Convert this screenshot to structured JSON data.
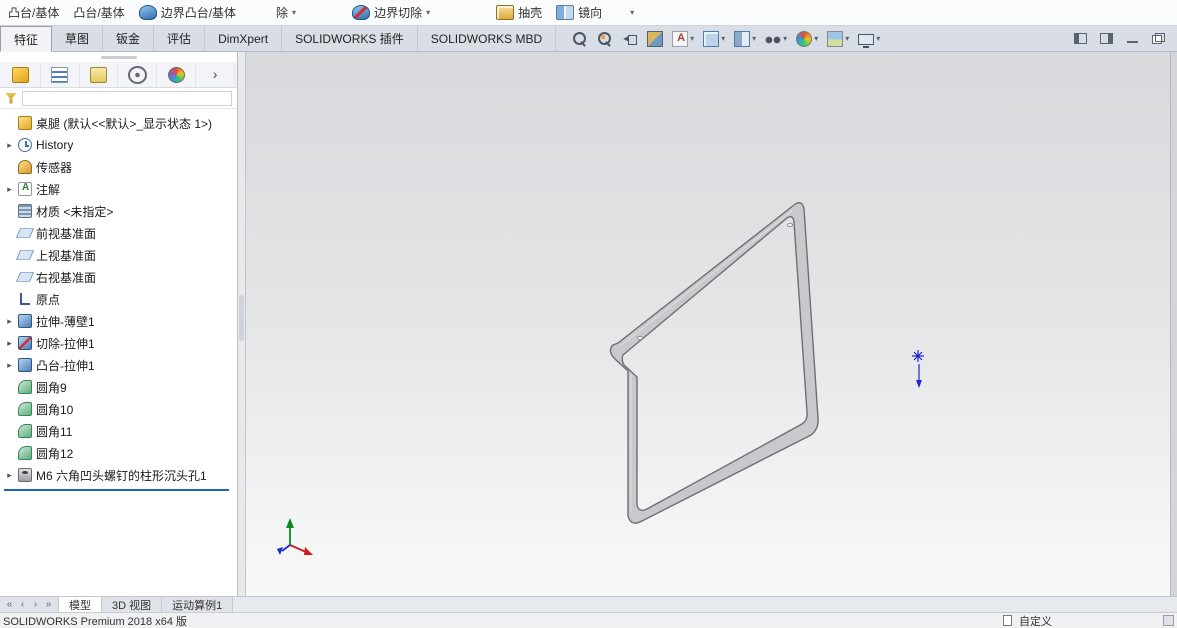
{
  "ribbon": {
    "items": [
      {
        "label": "凸台/基体",
        "icon": "",
        "caret": false
      },
      {
        "label": "凸台/基体",
        "icon": "",
        "caret": false
      },
      {
        "label": "边界凸台/基体",
        "icon": "boundary-boss-icon",
        "caret": false
      },
      {
        "label": "除",
        "icon": "",
        "caret": true
      },
      {
        "label": "边界切除",
        "icon": "boundary-cut-icon",
        "caret": true
      },
      {
        "label": "抽壳",
        "icon": "shell-icon",
        "caret": false
      },
      {
        "label": "镜向",
        "icon": "mirror-icon",
        "caret": false
      },
      {
        "label": "",
        "icon": "",
        "caret": true
      }
    ]
  },
  "tabs": [
    {
      "label": "特征",
      "active": true
    },
    {
      "label": "草图"
    },
    {
      "label": "钣金"
    },
    {
      "label": "评估"
    },
    {
      "label": "DimXpert"
    },
    {
      "label": "SOLIDWORKS 插件"
    },
    {
      "label": "SOLIDWORKS MBD"
    }
  ],
  "view_toolbar": [
    {
      "name": "zoom-fit-icon",
      "caret": false
    },
    {
      "name": "zoom-area-icon",
      "caret": false
    },
    {
      "name": "previous-view-icon",
      "caret": false
    },
    {
      "name": "section-view-icon",
      "caret": false
    },
    {
      "name": "annotation-view-icon",
      "caret": true
    },
    {
      "name": "view-orientation-icon",
      "caret": true
    },
    {
      "name": "display-style-icon",
      "caret": true
    },
    {
      "name": "hide-show-items-icon",
      "caret": true
    },
    {
      "name": "edit-appearance-icon",
      "caret": true
    },
    {
      "name": "apply-scene-icon",
      "caret": true
    },
    {
      "name": "view-settings-icon",
      "caret": true
    }
  ],
  "window_controls": [
    "panel-left-icon",
    "panel-right-icon",
    "minimize-icon",
    "restore-icon"
  ],
  "panel": {
    "tabs": [
      "part-tab-icon",
      "featuremanager-tab-icon",
      "configurationmanager-tab-icon",
      "dimxpertmanager-tab-icon",
      "displaymanager-tab-icon",
      "expand-panel-icon"
    ],
    "filter_value": ""
  },
  "tree": {
    "items": [
      {
        "label": "桌腿 (默认<<默认>_显示状态 1>)",
        "icon": "part-icon",
        "expand": false
      },
      {
        "label": "History",
        "icon": "history-icon",
        "expand": true
      },
      {
        "label": "传感器",
        "icon": "sensors-icon",
        "expand": false
      },
      {
        "label": "注解",
        "icon": "annotations-icon",
        "expand": true
      },
      {
        "label": "材质 <未指定>",
        "icon": "material-icon",
        "expand": false
      },
      {
        "label": "前视基准面",
        "icon": "plane-icon",
        "expand": false
      },
      {
        "label": "上视基准面",
        "icon": "plane-icon",
        "expand": false
      },
      {
        "label": "右视基准面",
        "icon": "plane-icon",
        "expand": false
      },
      {
        "label": "原点",
        "icon": "origin-icon",
        "expand": false
      },
      {
        "label": "拉伸-薄壁1",
        "icon": "extrude-thin-icon",
        "expand": true
      },
      {
        "label": "切除-拉伸1",
        "icon": "cut-extrude-icon",
        "expand": true
      },
      {
        "label": "凸台-拉伸1",
        "icon": "boss-extrude-icon",
        "expand": true
      },
      {
        "label": "圆角9",
        "icon": "fillet-icon",
        "expand": false
      },
      {
        "label": "圆角10",
        "icon": "fillet-icon",
        "expand": false
      },
      {
        "label": "圆角11",
        "icon": "fillet-icon",
        "expand": false
      },
      {
        "label": "圆角12",
        "icon": "fillet-icon",
        "expand": false
      },
      {
        "label": "M6 六角凹头螺钉的柱形沉头孔1",
        "icon": "hole-wizard-icon",
        "expand": true
      }
    ]
  },
  "bottom_nav": [
    "nav-first-icon",
    "nav-prev-icon",
    "nav-next-icon",
    "nav-last-icon"
  ],
  "bottom_tabs": [
    {
      "label": "模型",
      "active": true
    },
    {
      "label": "3D 视图"
    },
    {
      "label": "运动算例1"
    }
  ],
  "statusbar": {
    "left": "SOLIDWORKS Premium 2018 x64 版",
    "right": "自定义"
  },
  "colors": {
    "rollback_blue": "#1f62c5",
    "marker_blue": "#2424ce",
    "triad_x_red": "#cf1d1d",
    "triad_y_green": "#0a8a1f",
    "triad_z_blue": "#1d2ccf",
    "model_gray": "#c8c9cc"
  }
}
